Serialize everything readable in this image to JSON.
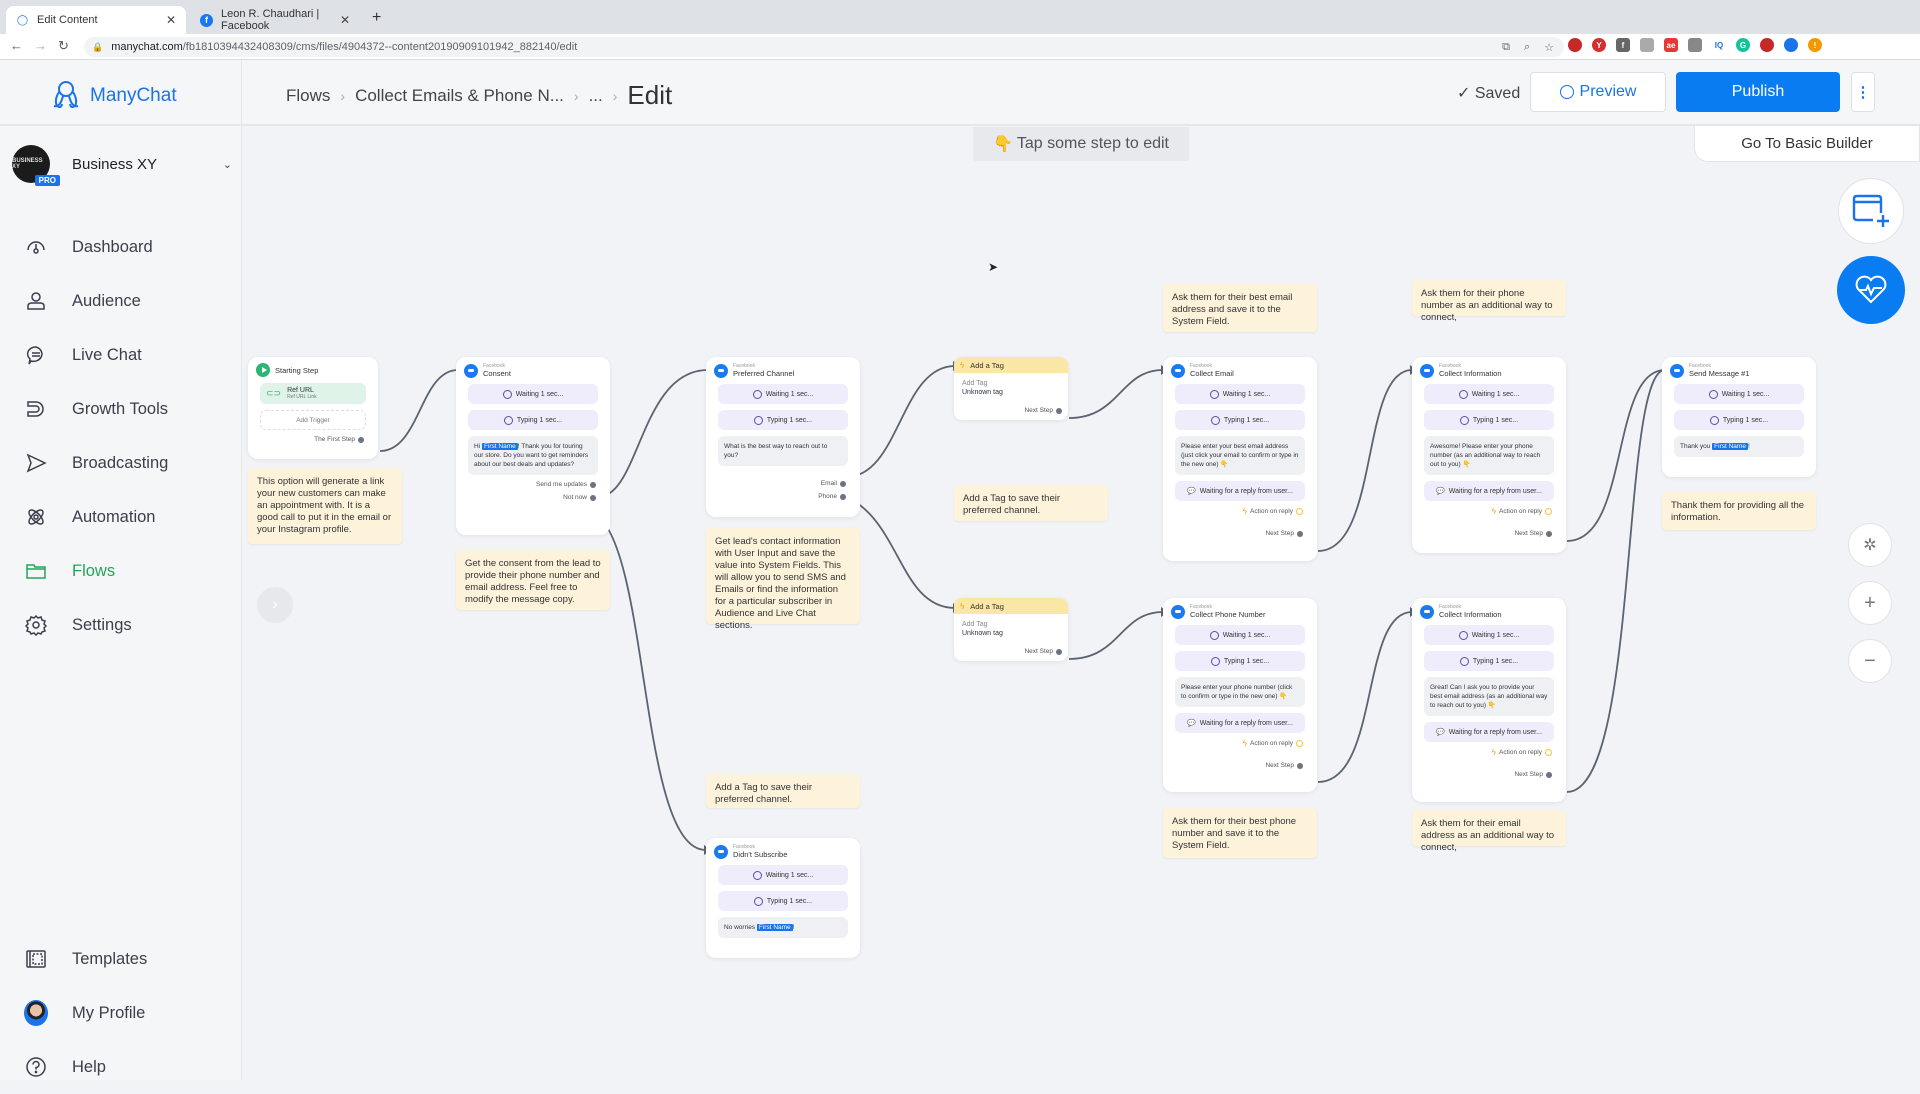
{
  "browser": {
    "tabs": [
      {
        "title": "Edit Content",
        "icon": "manychat-icon",
        "active": true
      },
      {
        "title": "Leon R. Chaudhari | Facebook",
        "icon": "facebook-icon",
        "active": false
      }
    ],
    "url_host": "manychat.com",
    "url_path": "/fb1810394432408309/cms/files/4904372--content20190909101942_882140/edit",
    "extension_badge": "1"
  },
  "sidebar": {
    "brand": "ManyChat",
    "account": {
      "name": "Business XY",
      "avatar_text": "BUSINESS XY",
      "badge": "PRO"
    },
    "items": [
      {
        "label": "Dashboard",
        "icon": "dashboard-icon"
      },
      {
        "label": "Audience",
        "icon": "audience-icon"
      },
      {
        "label": "Live Chat",
        "icon": "live-chat-icon"
      },
      {
        "label": "Growth Tools",
        "icon": "growth-tools-icon"
      },
      {
        "label": "Broadcasting",
        "icon": "broadcasting-icon"
      },
      {
        "label": "Automation",
        "icon": "automation-icon"
      },
      {
        "label": "Flows",
        "icon": "flows-icon",
        "active": true
      },
      {
        "label": "Settings",
        "icon": "settings-icon"
      }
    ],
    "bottom_items": [
      {
        "label": "Templates",
        "icon": "templates-icon"
      },
      {
        "label": "My Profile",
        "icon": "profile-avatar"
      },
      {
        "label": "Help",
        "icon": "help-icon"
      }
    ],
    "accent": "#23a55a"
  },
  "header": {
    "breadcrumb": [
      "Flows",
      "Collect Emails & Phone N...",
      "..."
    ],
    "title": "Edit",
    "saved_label": "Saved",
    "preview_label": "Preview",
    "publish_label": "Publish",
    "basic_builder_label": "Go To Basic Builder",
    "primary_color": "#0a7cf1"
  },
  "canvas": {
    "hint": "Tap some step to edit",
    "common": {
      "platform": "Facebook",
      "waiting": "Waiting 1 sec...",
      "typing": "Typing 1 sec...",
      "reply_wait": "Waiting for a reply from user...",
      "action_on_reply": "Action on reply",
      "next_step": "Next Step",
      "first_name": "First Name"
    },
    "start": {
      "title": "Starting Step",
      "trigger_title": "Ref URL",
      "trigger_sub": "Ref URL Link",
      "add_trigger": "Add Trigger",
      "port": "The First Step"
    },
    "consent": {
      "title": "Consent",
      "msg_pre": "Hi ",
      "msg_post": "! Thank you for touring our store. Do you want to get reminders about our best deals and updates?",
      "btn1": "Send me updates",
      "btn2": "Not now"
    },
    "preferred": {
      "title": "Preferred Channel",
      "msg": "What is the best way to reach out to you?",
      "btn1": "Email",
      "btn2": "Phone"
    },
    "tag1": {
      "title": "Add a Tag",
      "label": "Add Tag",
      "value": "Unknown tag",
      "port": "Next Step"
    },
    "tag2": {
      "title": "Add a Tag",
      "label": "Add Tag",
      "value": "Unknown tag",
      "port": "Next Step"
    },
    "collect_email": {
      "title": "Collect Email",
      "msg": "Please enter your best email address (just click your email to confirm or type in the new one) 👇"
    },
    "collect_info1": {
      "title": "Collect Information",
      "msg": "Awesome! Please enter your phone number (as an additional way to reach out to you) 👇"
    },
    "collect_phone": {
      "title": "Collect Phone Number",
      "msg": "Please enter your phone number (click to confirm or type in the new one) 👇"
    },
    "collect_info2": {
      "title": "Collect Information",
      "msg": "Great! Can I ask you to provide your best email address (as an additional way to reach out to you) 👇"
    },
    "send1": {
      "title": "Send Message #1",
      "msg_pre": "Thank you ",
      "msg_post": "!"
    },
    "didnt": {
      "title": "Didn't Subscribe",
      "msg_pre": "No worries ",
      "msg_post": "!"
    },
    "notes": {
      "start": "This option will generate a link your new customers can make an appointment with. It is a good call to put it in the email or your Instagram profile.",
      "consent": "Get the consent from the lead to provide their phone number and email address. Feel free to modify the message copy.",
      "preferred": "Get lead's contact information with User Input and save the value into System Fields. This will allow you to send SMS and Emails or find the information for a particular subscriber in Audience and Live Chat sections.",
      "tag_mid": "Add a Tag to save their preferred channel.",
      "tag_low": "Add a Tag to save their preferred channel.",
      "email": "Ask them for their best email address and save it to the System Field.",
      "phone_add": "Ask them for their phone number as an additional way to connect,",
      "phone": "Ask them for their best phone number and save it to the System Field.",
      "email_add": "Ask them for their email address as an additional way to connect,",
      "thanks": "Thank them for providing all the information."
    }
  }
}
